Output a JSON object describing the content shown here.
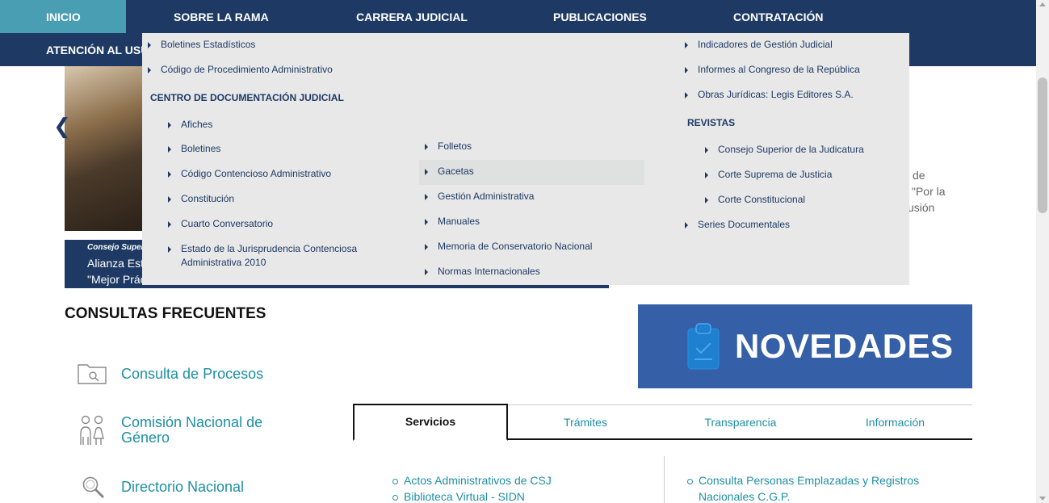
{
  "nav": {
    "items": [
      "INICIO",
      "SOBRE LA RAMA",
      "CARRERA JUDICIAL",
      "PUBLICACIONES",
      "CONTRATACIÓN"
    ],
    "second_row": "ATENCIÓN AL USU"
  },
  "carousel": {
    "prev_icon": "chevron-left-icon",
    "caption_category": "Consejo Superior",
    "caption_line1": "Alianza Est",
    "caption_line2": "\"Mejor Prác",
    "side_text_lines": [
      "de",
      "\"Por la",
      "usión"
    ]
  },
  "mega_menu": {
    "col1_top": [
      "Boletines Estadísticos",
      "Código de Procedimiento Administrativo"
    ],
    "col1_heading": "CENTRO DE DOCUMENTACIÓN JUDICIAL",
    "col1_sub": [
      "Afiches",
      "Boletines",
      "Código Contencioso Administrativo",
      "Constitución",
      "Cuarto Conversatorio",
      "Estado de la Jurisprudencia Contenciosa Administrativa 2010"
    ],
    "col2": [
      "Folletos",
      "Gacetas",
      "Gestión Administrativa",
      "Manuales",
      "Memoria de Conservatorio Nacional",
      "Normas Internacionales"
    ],
    "col3_top": [
      "Indicadores de Gestión Judicial",
      "Informes al Congreso de la República",
      "Obras Jurídicas: Legis Editores S.A."
    ],
    "col3_heading": "REVISTAS",
    "col3_sub": [
      "Consejo Superior de la Judicatura",
      "Corte Suprema de Justicia",
      "Corte Constitucional"
    ],
    "col3_bottom": [
      "Series Documentales"
    ]
  },
  "consultas": {
    "title": "CONSULTAS FRECUENTES",
    "items": [
      {
        "label": "Consulta de Procesos",
        "icon": "folder-search-icon"
      },
      {
        "label": "Comisión Nacional de Género",
        "icon": "people-icon"
      },
      {
        "label": "Directorio Nacional",
        "icon": "magnifier-icon"
      }
    ]
  },
  "novedades": {
    "label": "NOVEDADES",
    "icon": "clipboard-icon",
    "bg": "#355fa6"
  },
  "tabs": {
    "items": [
      "Servicios",
      "Trámites",
      "Transparencia",
      "Información"
    ],
    "active": "Servicios"
  },
  "services": {
    "col1": [
      "Actos Administrativos de CSJ",
      "Biblioteca Virtual - SIDN"
    ],
    "col2": [
      "Consulta Personas Emplazadas y Registros Nacionales C.G.P."
    ]
  },
  "colors": {
    "navy": "#1e3a64",
    "teal": "#4a9eb3",
    "link": "#1e8fa4",
    "menu_bg": "#e8e8e8"
  }
}
